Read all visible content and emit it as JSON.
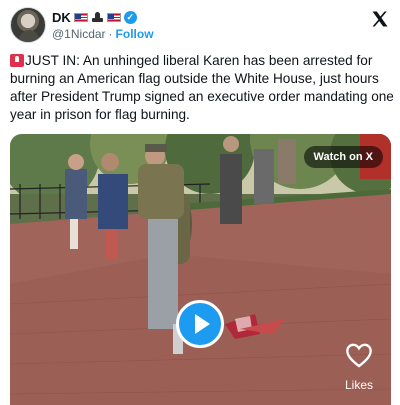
{
  "user": {
    "display_name": "DK",
    "handle": "@1Nicdar",
    "separator": "·",
    "follow_label": "Follow",
    "name_emojis": [
      "us-flag-icon",
      "military-icon",
      "us-flag-icon"
    ],
    "verified_icon": "verified-badge-icon"
  },
  "brand": {
    "logo": "x-logo-icon"
  },
  "tweet": {
    "prefix_icon": "siren-icon",
    "text": "JUST IN: An unhinged liberal Karen has been arrested for burning an American flag outside the White House, just hours after President Trump signed an executive order mandating one year in prison for flag burning."
  },
  "media": {
    "watch_label": "Watch on X",
    "play_icon": "play-icon",
    "likes_icon": "heart-icon",
    "likes_label": "Likes"
  },
  "colors": {
    "accent": "#1d9bf0",
    "text": "#0f1419",
    "muted": "#536471",
    "siren": "#e0304e"
  }
}
